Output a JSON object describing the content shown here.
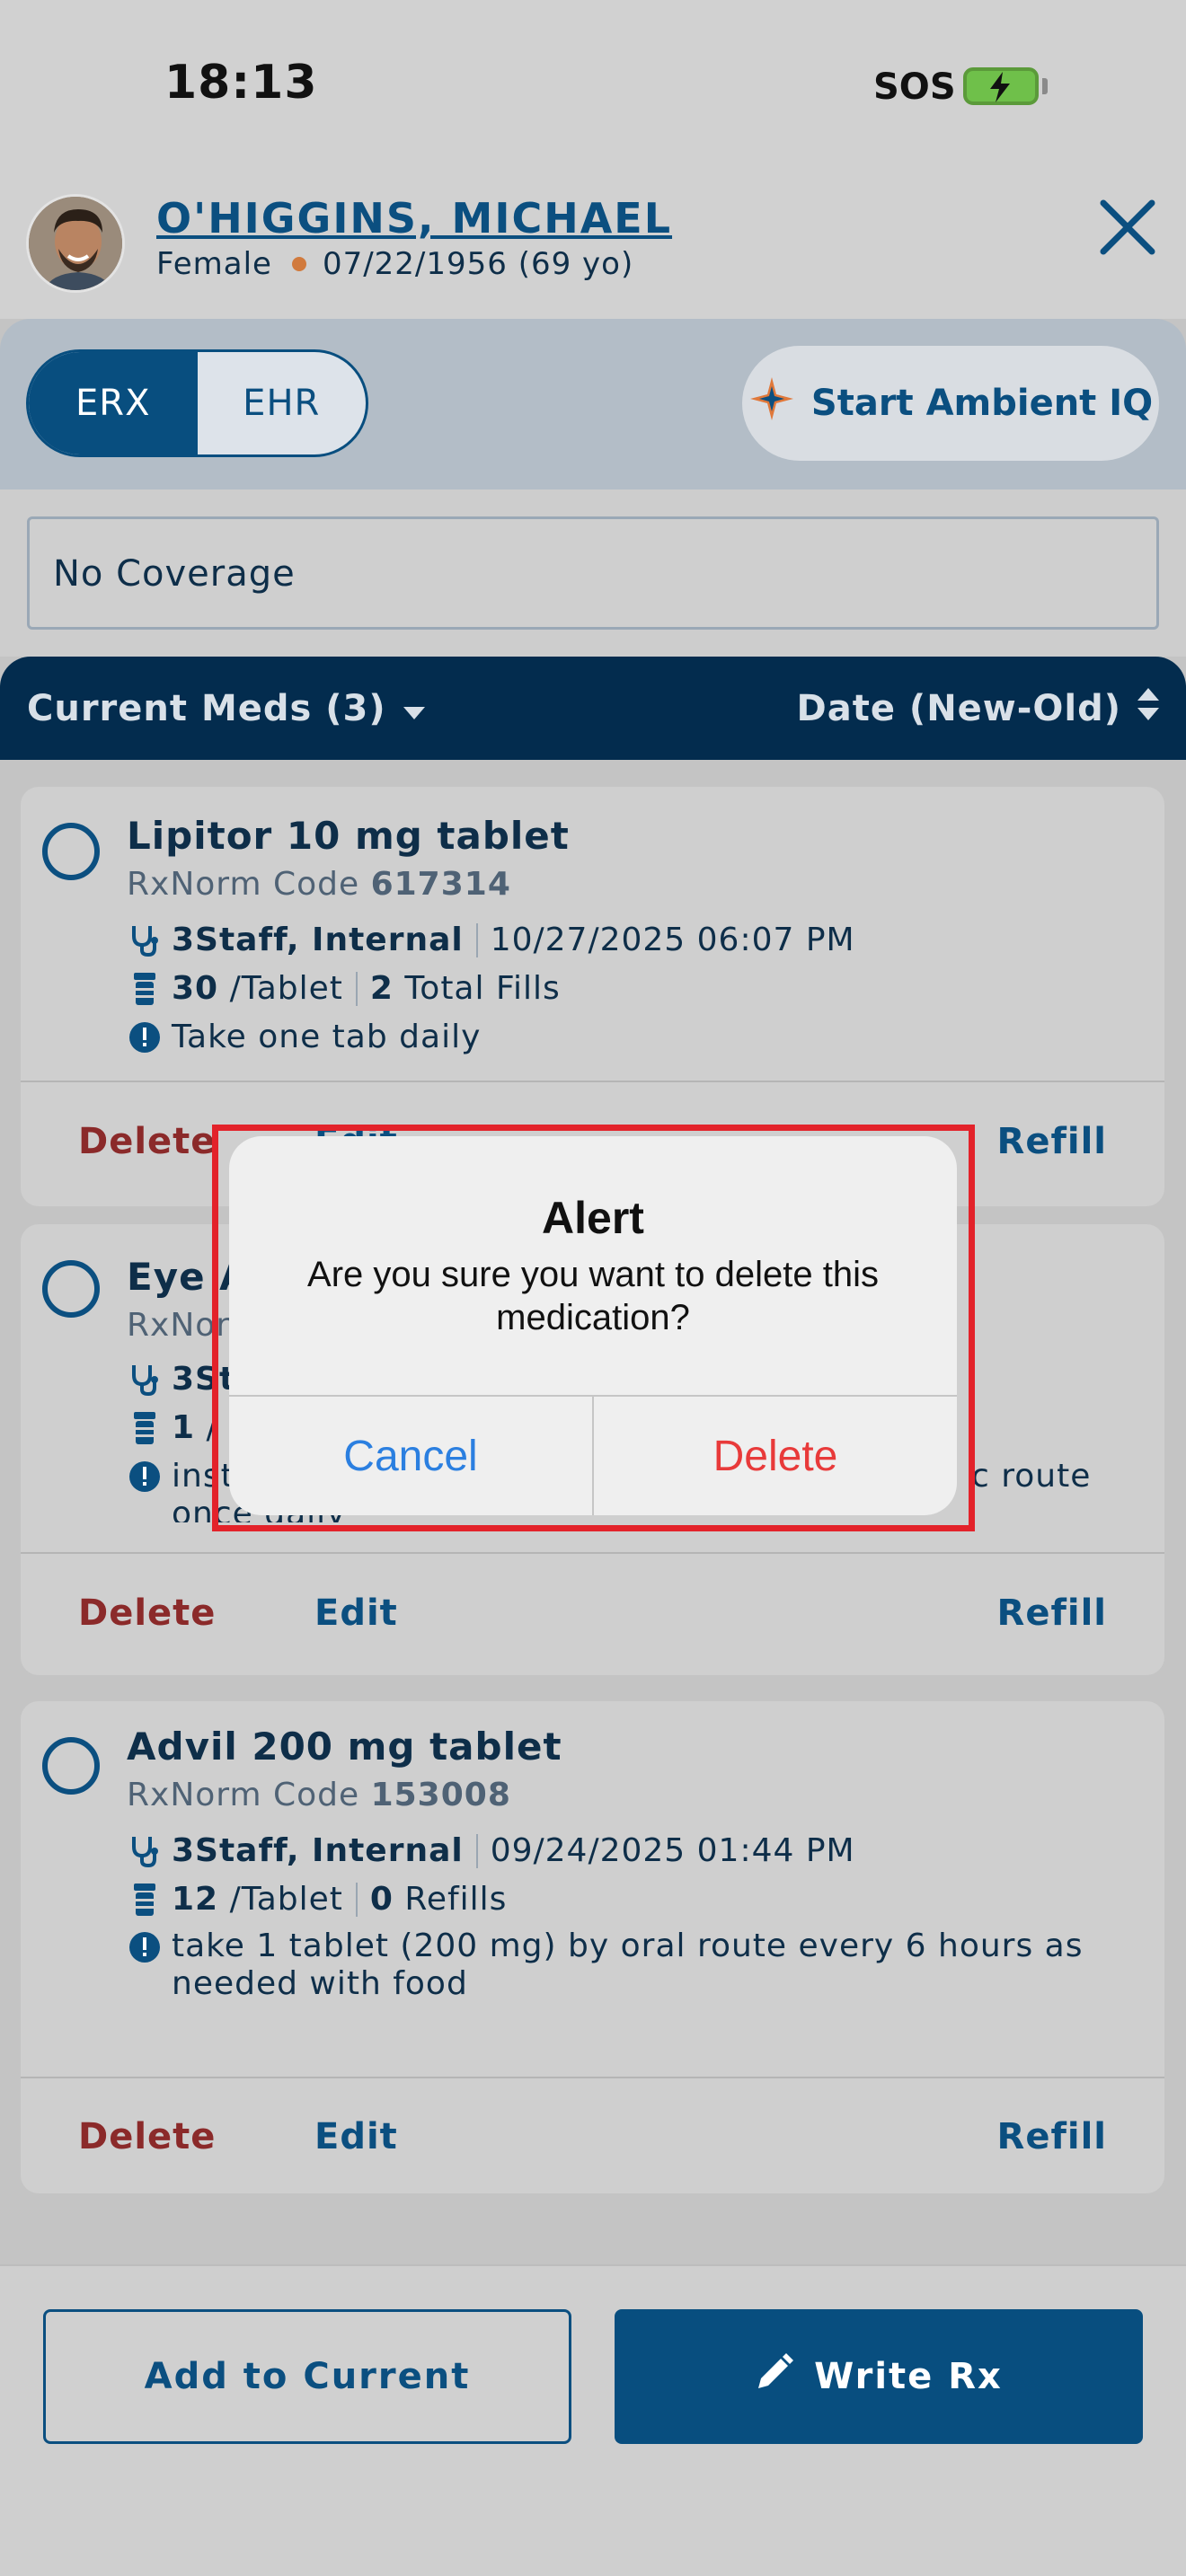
{
  "status_bar": {
    "time": "18:13",
    "sos": "SOS",
    "battery_color": "#6fc04a"
  },
  "patient": {
    "name": "O'HIGGINS, MICHAEL",
    "sex": "Female",
    "dob_age": "07/22/1956 (69 yo)",
    "close_icon": "close-icon"
  },
  "toggle": {
    "options": [
      "ERX",
      "EHR"
    ],
    "selected": "ERX"
  },
  "ambient_button": {
    "label": "Start Ambient IQ",
    "icon": "sparkle-icon"
  },
  "coverage": {
    "text": "No Coverage"
  },
  "list_header": {
    "filter_label": "Current Meds (3)",
    "sort_label": "Date (New-Old)"
  },
  "medications": [
    {
      "name": "Lipitor 10 mg tablet",
      "rxnorm_label": "RxNorm Code",
      "rxnorm_code": "617314",
      "prescriber": "3Staff, Internal",
      "date": "10/27/2025 06:07 PM",
      "quantity": "30",
      "unit": "/Tablet",
      "fills_count": "2",
      "fills_label": "Total Fills",
      "sig": "Take one tab daily"
    },
    {
      "name": "Eye A",
      "rxnorm_label": "RxNor",
      "prescriber": "3St",
      "quantity": "1",
      "unit": "/",
      "sig_start": "inst",
      "sig_end": "c route",
      "sig_line2": "once daily"
    },
    {
      "name": "Advil 200 mg tablet",
      "rxnorm_label": "RxNorm Code",
      "rxnorm_code": "153008",
      "prescriber": "3Staff, Internal",
      "date": "09/24/2025 01:44 PM",
      "quantity": "12",
      "unit": "/Tablet",
      "fills_count": "0",
      "fills_label": "Refills",
      "sig": "take 1 tablet (200 mg) by oral route every 6 hours as needed with food"
    }
  ],
  "card_actions": {
    "delete": "Delete",
    "edit": "Edit",
    "edit_partial": "Edit",
    "refill": "Refill"
  },
  "bottom": {
    "add_label": "Add to Current",
    "write_label": "Write Rx",
    "write_icon": "pencil-icon"
  },
  "alert": {
    "title": "Alert",
    "message": "Are you sure you want to delete this medication?",
    "cancel": "Cancel",
    "delete": "Delete",
    "highlight_color": "#e3222a"
  }
}
